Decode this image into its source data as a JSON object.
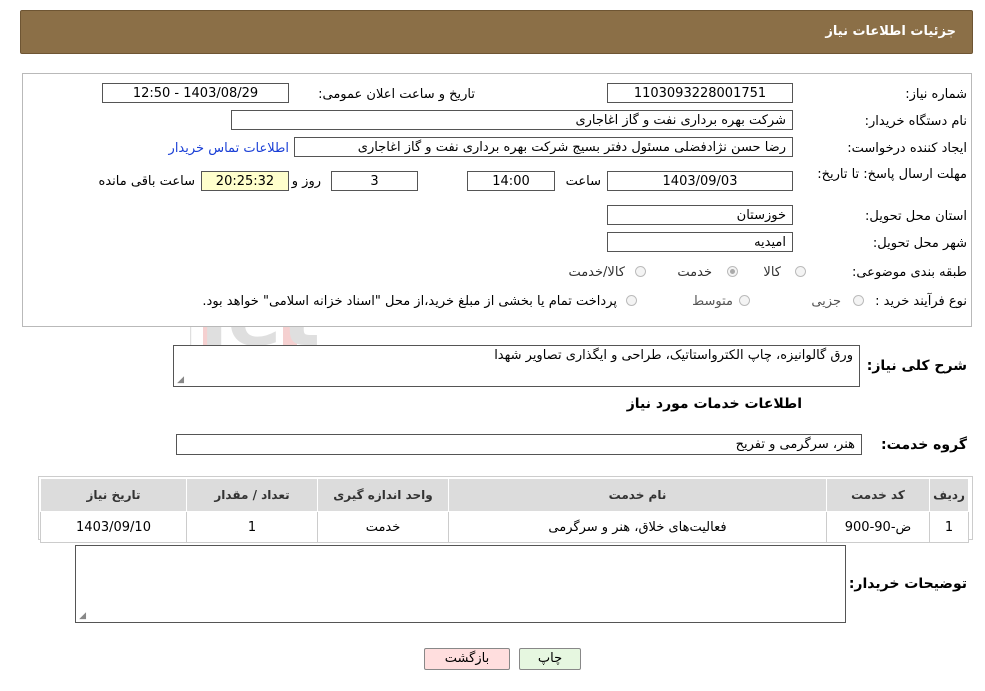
{
  "header": {
    "title": "جزئیات اطلاعات نیاز"
  },
  "form": {
    "need_number_label": "شماره نیاز:",
    "need_number": "1103093228001751",
    "announce_datetime_label": "تاریخ و ساعت اعلان عمومی:",
    "announce_datetime": "1403/08/29 - 12:50",
    "buyer_org_label": "نام دستگاه خریدار:",
    "buyer_org": "شرکت بهره برداری نفت و گاز اغاجاری",
    "requester_label": "ایجاد کننده درخواست:",
    "requester": "رضا حسن نژادفضلی مسئول دفتر بسیج شرکت بهره برداری نفت و گاز اغاجاری",
    "buyer_contact_link": "اطلاعات تماس خریدار",
    "deadline_label": "مهلت ارسال پاسخ: تا تاریخ:",
    "deadline_date": "1403/09/03",
    "time_label": "ساعت",
    "deadline_time": "14:00",
    "days_value": "3",
    "days_label": "روز و",
    "remaining_time": "20:25:32",
    "remaining_label": "ساعت باقی مانده",
    "province_label": "استان محل تحویل:",
    "province": "خوزستان",
    "city_label": "شهر محل تحویل:",
    "city": "امیدیه",
    "category_label": "طبقه بندی موضوعی:",
    "category_options": [
      {
        "label": "کالا",
        "checked": false
      },
      {
        "label": "خدمت",
        "checked": true
      },
      {
        "label": "کالا/خدمت",
        "checked": false
      }
    ],
    "purchase_type_label": "نوع فرآیند خرید :",
    "purchase_type_options": [
      {
        "label": "جزیی",
        "checked": false
      },
      {
        "label": "متوسط",
        "checked": false
      }
    ],
    "payment_note": "پرداخت تمام یا بخشی از مبلغ خرید،از محل \"اسناد خزانه اسلامی\" خواهد بود."
  },
  "summary": {
    "label": "شرح کلی نیاز:",
    "value": "ورق گالوانیزه، چاپ الکترواستاتیک، طراحی و ایگذاری تصاویر شهدا"
  },
  "services": {
    "section_title": "اطلاعات خدمات مورد نیاز",
    "group_label": "گروه خدمت:",
    "group_value": "هنر، سرگرمی و تفریح",
    "table": {
      "headers": [
        "ردیف",
        "کد خدمت",
        "نام خدمت",
        "واحد اندازه گیری",
        "تعداد / مقدار",
        "تاریخ نیاز"
      ],
      "rows": [
        [
          "1",
          "ض-90-900",
          "فعالیت‌های خلاق، هنر و سرگرمی",
          "خدمت",
          "1",
          "1403/09/10"
        ]
      ]
    }
  },
  "buyer_notes": {
    "label": "توضیحات خریدار:",
    "value": ""
  },
  "buttons": {
    "print": "چاپ",
    "back": "بازگشت"
  },
  "watermark": {
    "text": "AriaTender.net"
  },
  "colors": {
    "header_bg": "#8b6f47",
    "link": "#1a3fd6",
    "remaining_bg": "#ffffcc",
    "back_btn_bg": "#ffdede",
    "print_btn_bg": "#e6f7e0"
  }
}
